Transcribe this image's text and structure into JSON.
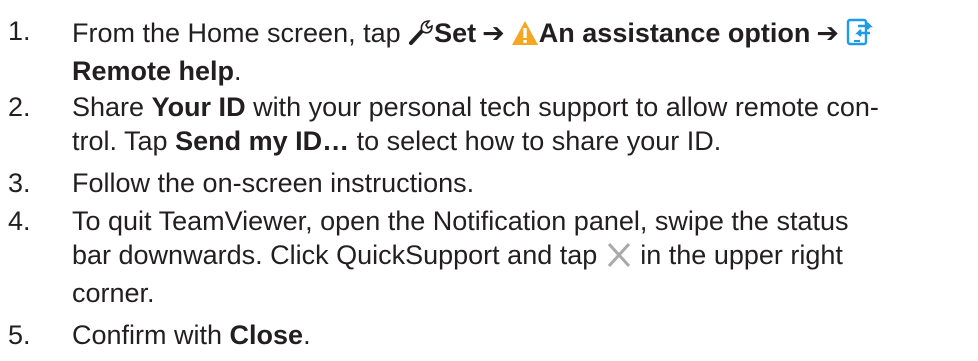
{
  "steps": [
    {
      "number": "1.",
      "text_a": "From the Home screen, tap ",
      "set_label": "Set",
      "assist_label": "An assistance option",
      "arrow": "➔",
      "remote_label": "Remote help",
      "end": ".",
      "icons": [
        "wrench-icon",
        "warning-icon",
        "phone-remote-icon"
      ]
    },
    {
      "number": "2.",
      "text_a": "Share ",
      "your_id": "Your ID",
      "text_b": " with your personal tech support to allow remote con-",
      "text_c": "trol. Tap ",
      "send_id": "Send my ID…",
      "text_d": " to select how to share your ID."
    },
    {
      "number": "3.",
      "text": "Follow the on-screen instructions."
    },
    {
      "number": "4.",
      "text_a": "To quit TeamViewer, open the Notification panel, swipe the status",
      "text_b": "bar downwards. Click QuickSupport and tap ",
      "text_c": " in the upper right",
      "text_d": "corner.",
      "icons": [
        "close-x-icon"
      ]
    },
    {
      "number": "5.",
      "text_a": "Confirm with ",
      "close_label": "Close",
      "end": "."
    }
  ],
  "colors": {
    "text": "#231f20",
    "warning": "#f5a623",
    "remote_icon": "#1e9be9",
    "close_x": "#a9a9a9"
  }
}
